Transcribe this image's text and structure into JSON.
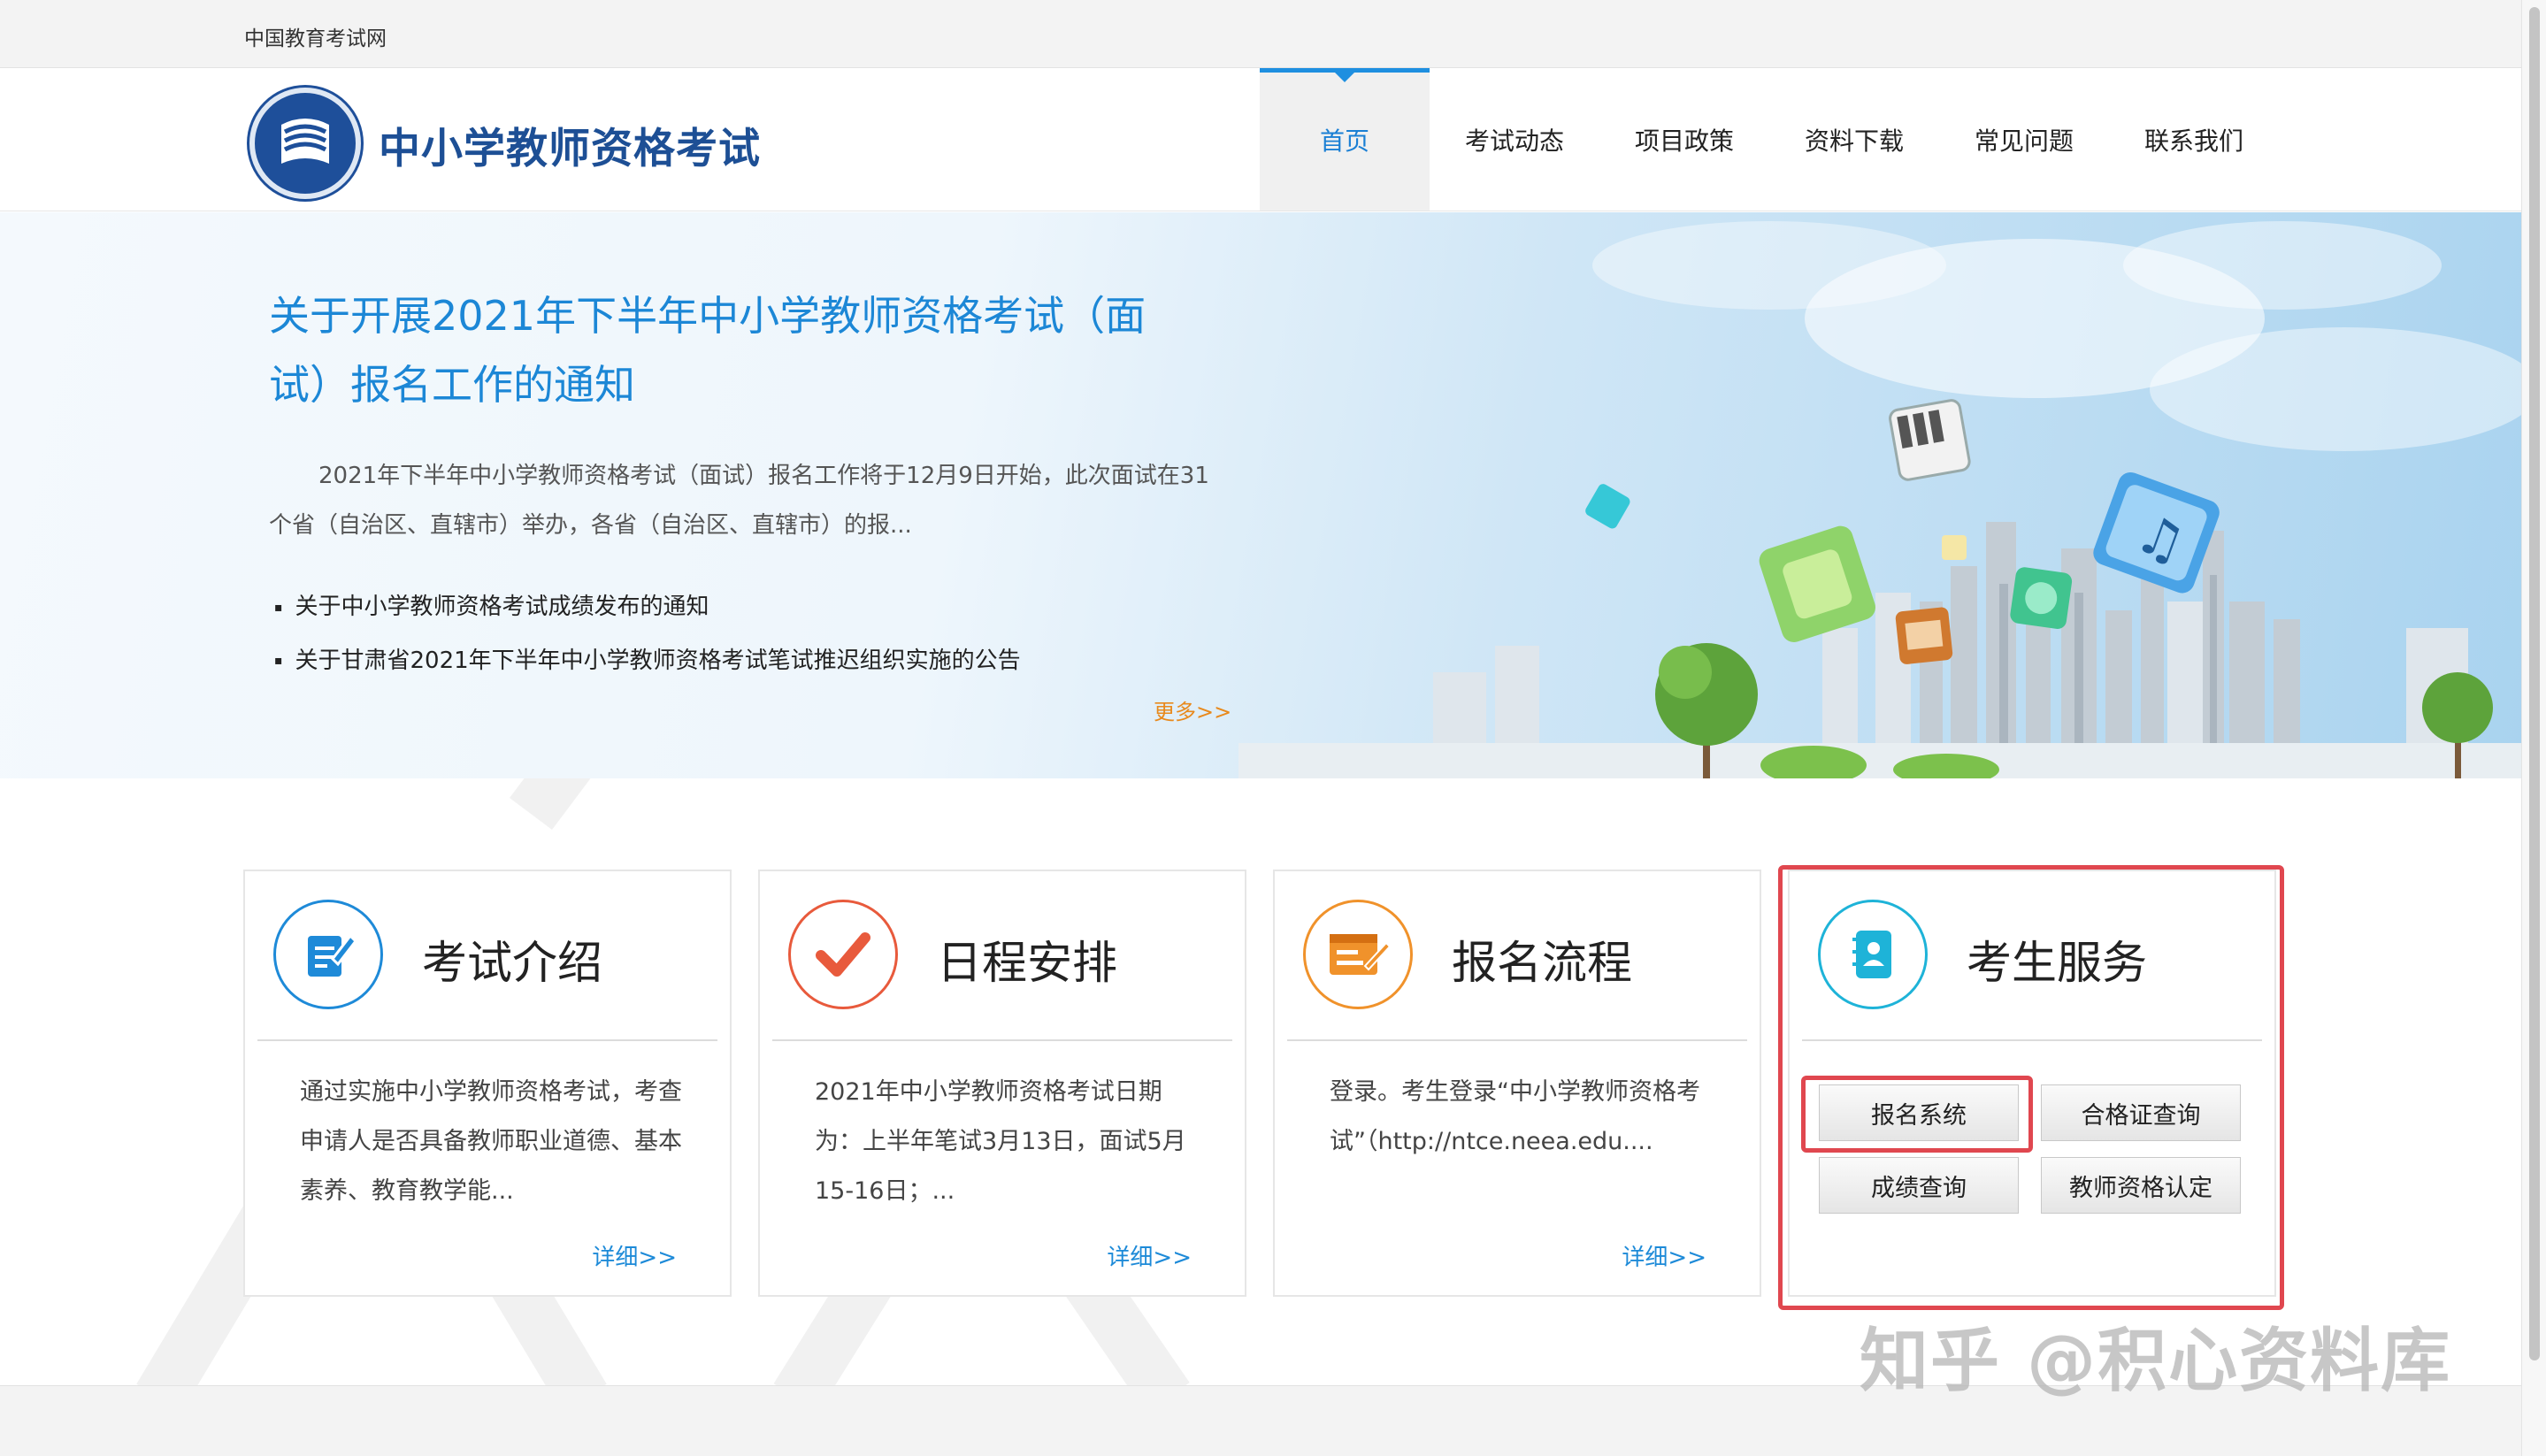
{
  "topbar": {
    "site_name": "中国教育考试网"
  },
  "header": {
    "brand": "中小学教师资格考试"
  },
  "nav": [
    {
      "label": "首页",
      "active": true
    },
    {
      "label": "考试动态"
    },
    {
      "label": "项目政策"
    },
    {
      "label": "资料下载"
    },
    {
      "label": "常见问题"
    },
    {
      "label": "联系我们"
    }
  ],
  "banner": {
    "headline": "关于开展2021年下半年中小学教师资格考试（面试）报名工作的通知",
    "summary": "2021年下半年中小学教师资格考试（面试）报名工作将于12月9日开始，此次面试在31个省（自治区、直辖市）举办，各省（自治区、直辖市）的报...",
    "news": [
      "关于中小学教师资格考试成绩发布的通知",
      "关于甘肃省2021年下半年中小学教师资格考试笔试推迟组织实施的公告"
    ],
    "more": "更多>>"
  },
  "cards": [
    {
      "title": "考试介绍",
      "icon": "document-edit-icon",
      "color": "#1e8ad8",
      "desc": "通过实施中小学教师资格考试，考查申请人是否具备教师职业道德、基本素养、教育教学能...",
      "detail": "详细>>"
    },
    {
      "title": "日程安排",
      "icon": "checkmark-icon",
      "color": "#e85a3c",
      "desc": "2021年中小学教师资格考试日期为：上半年笔试3月13日，面试5月15-16日；...",
      "detail": "详细>>"
    },
    {
      "title": "报名流程",
      "icon": "form-pen-icon",
      "color": "#f0922b",
      "desc": "登录。考生登录“中小学教师资格考试”（http://ntce.neea.edu....",
      "detail": "详细>>"
    }
  ],
  "service": {
    "title": "考生服务",
    "icon": "contact-book-icon",
    "color": "#1eb3d8",
    "buttons": {
      "register": "报名系统",
      "certificate": "合格证查询",
      "score": "成绩查询",
      "qualification": "教师资格认定"
    }
  },
  "watermark": "知乎 @积心资料库",
  "colors": {
    "accent": "#1a7fd4",
    "brand": "#1d4f95",
    "highlight": "#e0474f",
    "more": "#e8891c"
  }
}
